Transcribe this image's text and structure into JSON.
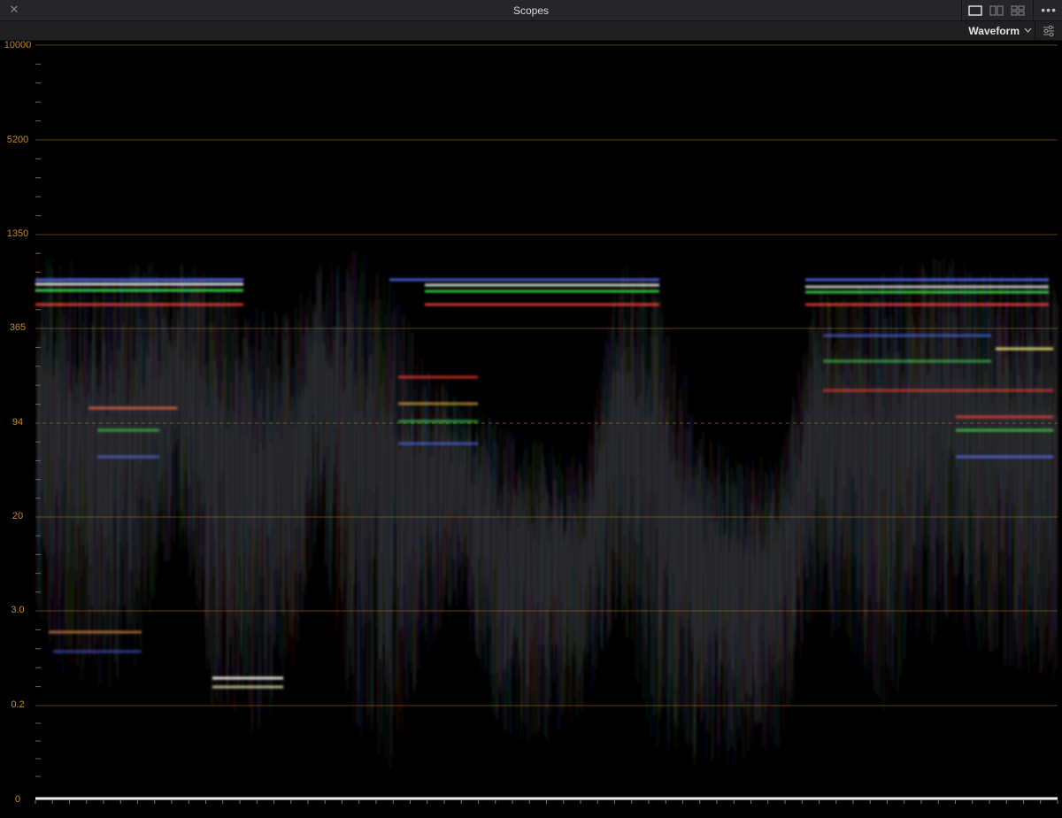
{
  "window": {
    "title": "Scopes",
    "close_icon": "close-icon",
    "more_icon": "more-horizontal-icon"
  },
  "toolbar": {
    "mode": "Waveform",
    "mode_chevron": "chevron-down-icon",
    "settings_icon": "sliders-icon",
    "layouts": [
      "single-view-icon",
      "dual-view-icon",
      "quad-view-icon"
    ]
  },
  "scale": {
    "labels": [
      "10000",
      "5200",
      "1350",
      "365",
      "94",
      "20",
      "3.0",
      "0.2",
      "0"
    ],
    "label_color": "#c48a1e",
    "reference_line_label": "94"
  },
  "colors": {
    "accent": "#c48a1e",
    "trace_red": "#ff3a2a",
    "trace_green": "#38e040",
    "trace_blue": "#3a4cff"
  }
}
